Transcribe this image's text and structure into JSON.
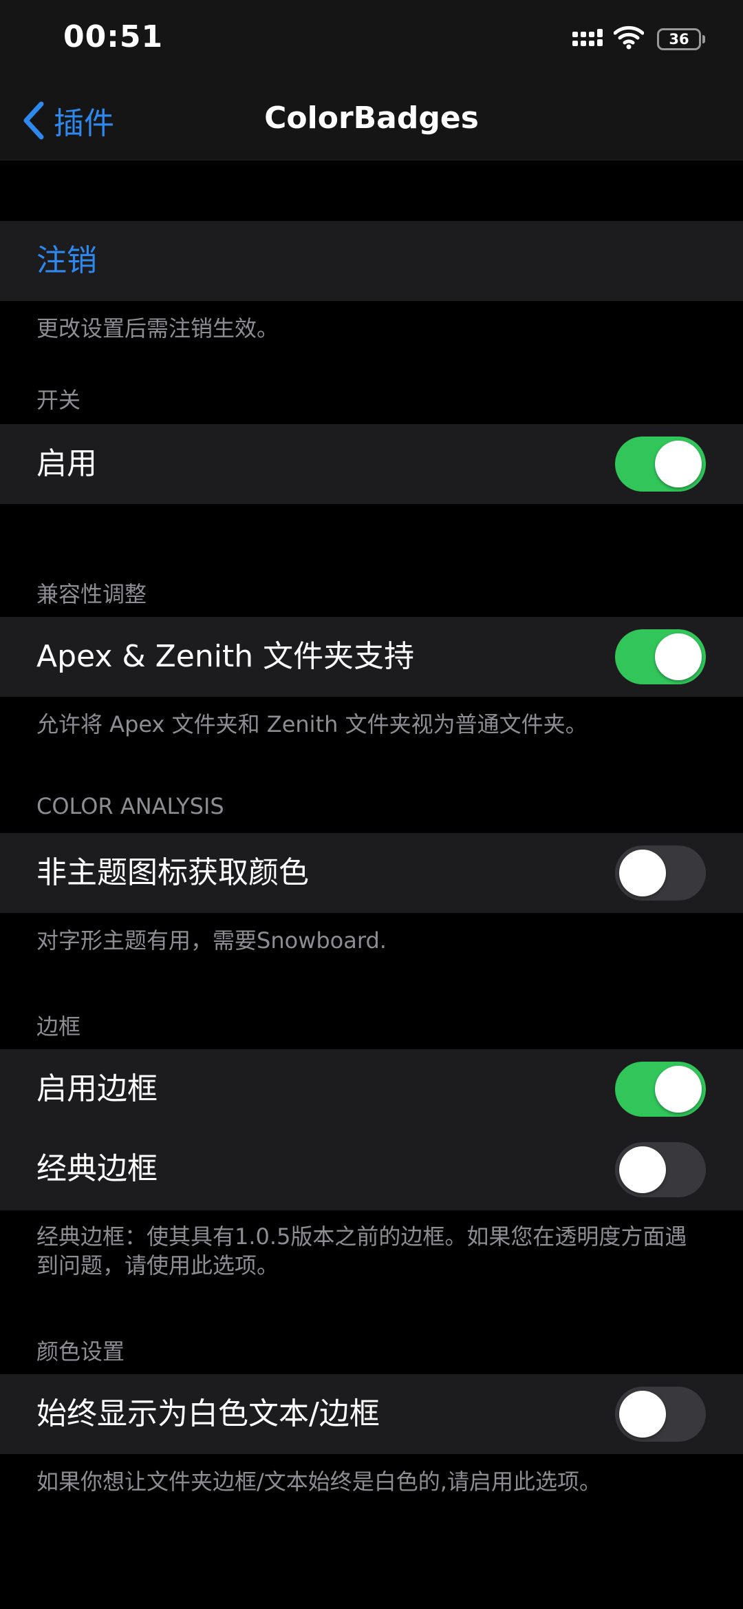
{
  "status_bar": {
    "time": "00:51",
    "battery": "36",
    "icons": [
      "signal-icon",
      "wifi-icon",
      "battery-icon"
    ]
  },
  "nav": {
    "back_label": "插件",
    "title": "ColorBadges",
    "back_icon": "chevron-left-icon"
  },
  "respring": {
    "label": "注销",
    "footer": "更改设置后需注销生效。"
  },
  "switch_section": {
    "header": "开关",
    "enable_label": "启用",
    "enable_on": true
  },
  "compat_section": {
    "header": "兼容性调整",
    "apex_label": "Apex & Zenith 文件夹支持",
    "apex_on": true,
    "footer": "允许将 Apex 文件夹和 Zenith 文件夹视为普通文件夹。"
  },
  "color_analysis": {
    "header": "COLOR ANALYSIS",
    "nontheme_label": "非主题图标获取颜色",
    "nontheme_on": false,
    "footer": "对字形主题有用，需要Snowboard."
  },
  "border_section": {
    "header": "边框",
    "enable_border_label": "启用边框",
    "enable_border_on": true,
    "classic_border_label": "经典边框",
    "classic_border_on": false,
    "footer": "经典边框：使其具有1.0.5版本之前的边框。如果您在透明度方面遇到问题，请使用此选项。"
  },
  "color_section": {
    "header": "颜色设置",
    "white_label": "始终显示为白色文本/边框",
    "white_on": false,
    "footer": "如果你想让文件夹边框/文本始终是白色的,请启用此选项。"
  },
  "colors": {
    "accent": "#2f88ee",
    "toggle_on": "#31c55a",
    "toggle_off": "#39393d",
    "cell_bg": "#1c1c1e",
    "secondary_text": "#8d8d93"
  }
}
